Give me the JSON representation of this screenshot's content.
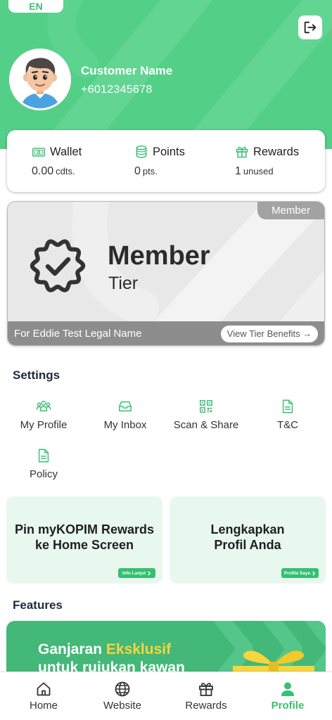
{
  "colors": {
    "brand_green": "#54cf88",
    "accent_green": "#3cbf73",
    "tier_gray": "#8d8d8d",
    "banner_green": "#43b878",
    "highlight_yellow": "#f7d53c"
  },
  "language_badge": "EN",
  "header": {
    "logout_icon": "logout-icon"
  },
  "profile": {
    "avatar": "avatar-3d-boy",
    "name": "Customer Name",
    "phone": "+6012345678"
  },
  "stats": {
    "wallet": {
      "icon": "wallet-icon",
      "label": "Wallet",
      "value": "0.00",
      "unit": "cdts."
    },
    "points": {
      "icon": "coins-icon",
      "label": "Points",
      "value": "0",
      "unit": "pts."
    },
    "rewards": {
      "icon": "gift-icon",
      "label": "Rewards",
      "value": "1",
      "unit": "unused"
    }
  },
  "tier_card": {
    "tag": "Member",
    "badge_icon": "badge-check-icon",
    "title": "Member",
    "subtitle": "Tier",
    "holder": "For Eddie Test Legal Name",
    "benefits_button": "View Tier Benefits →"
  },
  "settings": {
    "heading": "Settings",
    "items": [
      {
        "label": "My Profile",
        "icon": "users-icon"
      },
      {
        "label": "My Inbox",
        "icon": "inbox-icon"
      },
      {
        "label": "Scan & Share",
        "icon": "qr-code-icon"
      },
      {
        "label": "T&C",
        "icon": "document-icon"
      },
      {
        "label": "Policy",
        "icon": "document-icon"
      }
    ]
  },
  "promos": [
    {
      "line1": "Pin myKOPIM Rewards",
      "line2": "ke Home Screen",
      "button": "Info Lanjut"
    },
    {
      "line1": "Lengkapkan",
      "line2": "Profil Anda",
      "button": "Profile Saya"
    }
  ],
  "features": {
    "heading": "Features",
    "banner": {
      "line1_a": "Ganjaran",
      "line1_b": "Eksklusif",
      "line2": "untuk rujukan kawan",
      "image_icon": "gift-ribbon-icon"
    }
  },
  "bottom_nav": {
    "active": "Profile",
    "items": [
      {
        "label": "Home",
        "icon": "home-icon"
      },
      {
        "label": "Website",
        "icon": "globe-icon"
      },
      {
        "label": "Rewards",
        "icon": "gift-icon"
      },
      {
        "label": "Profile",
        "icon": "user-icon"
      }
    ]
  }
}
